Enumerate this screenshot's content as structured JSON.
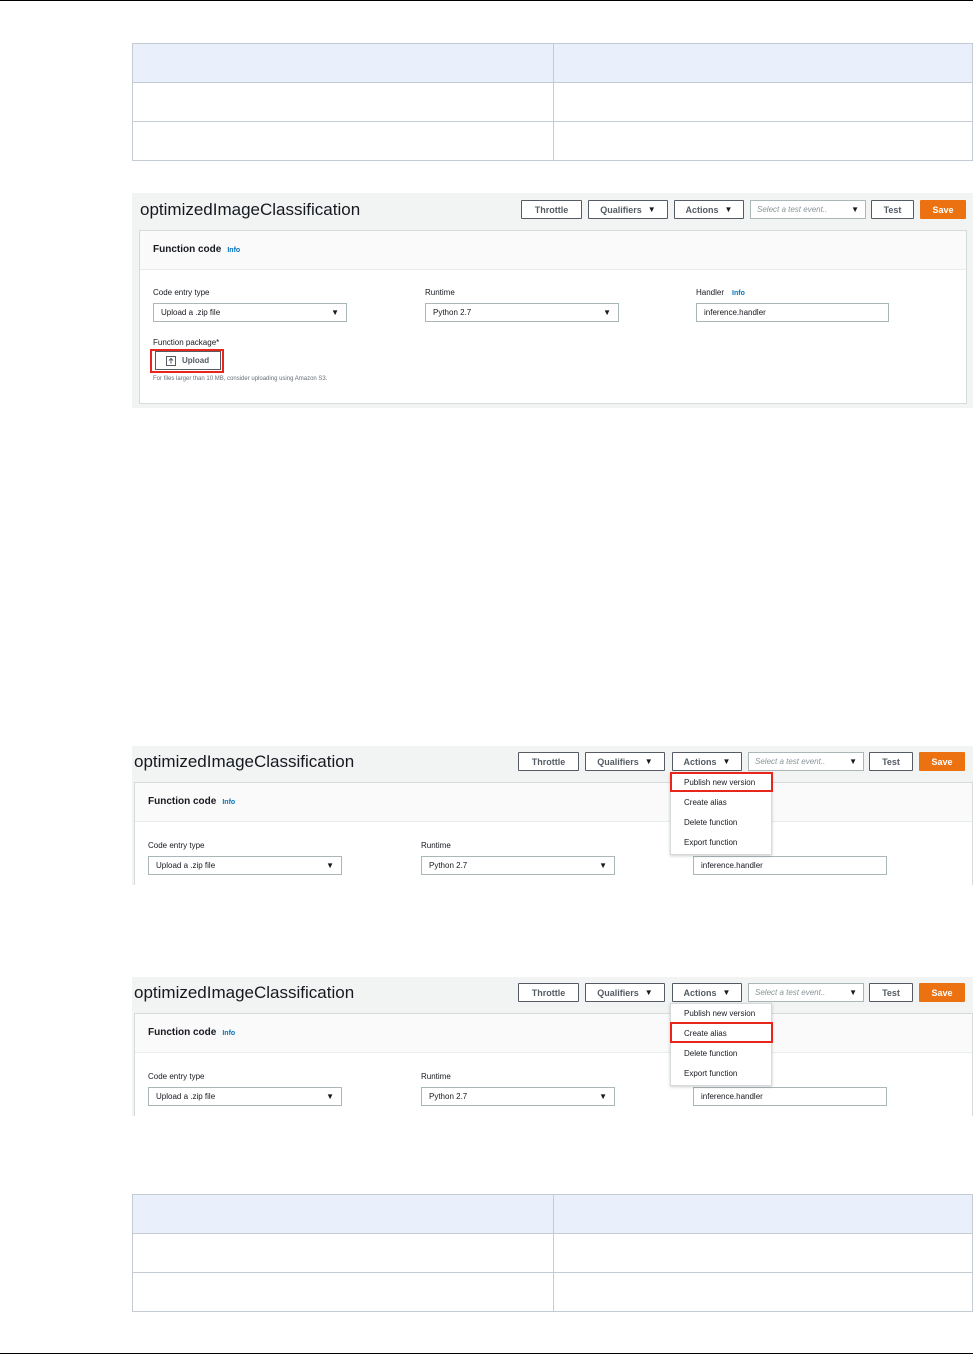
{
  "tables": {
    "top": {
      "rows": [
        [
          "",
          ""
        ],
        [
          "",
          ""
        ],
        [
          "",
          ""
        ]
      ]
    },
    "bottom": {
      "rows": [
        [
          "",
          ""
        ],
        [
          "",
          ""
        ],
        [
          "",
          ""
        ]
      ]
    }
  },
  "console": {
    "function_name": "optimizedImageClassification",
    "toolbar": {
      "throttle": "Throttle",
      "qualifiers": "Qualifiers",
      "actions": "Actions",
      "test_event_placeholder": "Select a test event..",
      "test": "Test",
      "save": "Save"
    },
    "function_code": {
      "title": "Function code",
      "info": "Info",
      "code_entry_type_label": "Code entry type",
      "code_entry_type_value": "Upload a .zip file",
      "runtime_label": "Runtime",
      "runtime_value": "Python 2.7",
      "handler_label": "Handler",
      "handler_info": "Info",
      "handler_value": "inference.handler",
      "package_label": "Function package*",
      "upload_label": "Upload",
      "upload_hint": "For files larger than 10 MB, consider uploading using Amazon S3."
    },
    "actions_menu": [
      "Publish new version",
      "Create alias",
      "Delete function",
      "Export function"
    ]
  },
  "colors": {
    "accent": "#ec7211",
    "highlight": "#e8261c",
    "link": "#0073bb"
  }
}
